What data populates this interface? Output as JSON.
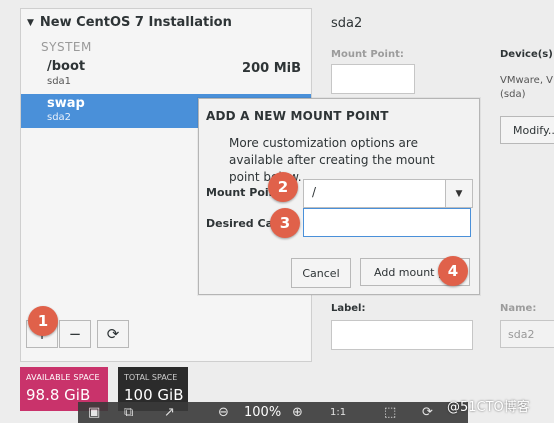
{
  "left_panel": {
    "title": "New CentOS 7 Installation",
    "section": "SYSTEM",
    "rows": [
      {
        "name": "/boot",
        "device": "sda1",
        "size": "200 MiB"
      },
      {
        "name": "swap",
        "device": "sda2",
        "size": ""
      }
    ],
    "toolbar": {
      "add": "+",
      "remove": "−",
      "refresh": "⟳"
    }
  },
  "space": {
    "available_label": "AVAILABLE SPACE",
    "available_value": "98.8 GiB",
    "total_label": "TOTAL SPACE",
    "total_value": "100 GiB"
  },
  "right_panel": {
    "title": "sda2",
    "mount_point_label": "Mount Point:",
    "devices_label": "Device(s):",
    "devices_value_line1": "VMware, V",
    "devices_value_line2": "(sda)",
    "modify_label": "Modify...",
    "label_label": "Label:",
    "name_label": "Name:",
    "name_value": "sda2"
  },
  "modal": {
    "title": "ADD A NEW MOUNT POINT",
    "description": "More customization options are available after creating the mount point below.",
    "mount_point_label": "Mount Poin",
    "mount_point_value": "/",
    "capacity_label": "Desired Cap",
    "capacity_value": "",
    "cancel_label": "Cancel",
    "add_label": "Add mount p"
  },
  "badges": [
    "1",
    "2",
    "3",
    "4"
  ],
  "viewer": {
    "zoom": "100%"
  },
  "watermark": "@51CTO博客",
  "colors": {
    "accent": "#4a90d9",
    "available": "#c9336b",
    "badge": "#e0614a"
  }
}
